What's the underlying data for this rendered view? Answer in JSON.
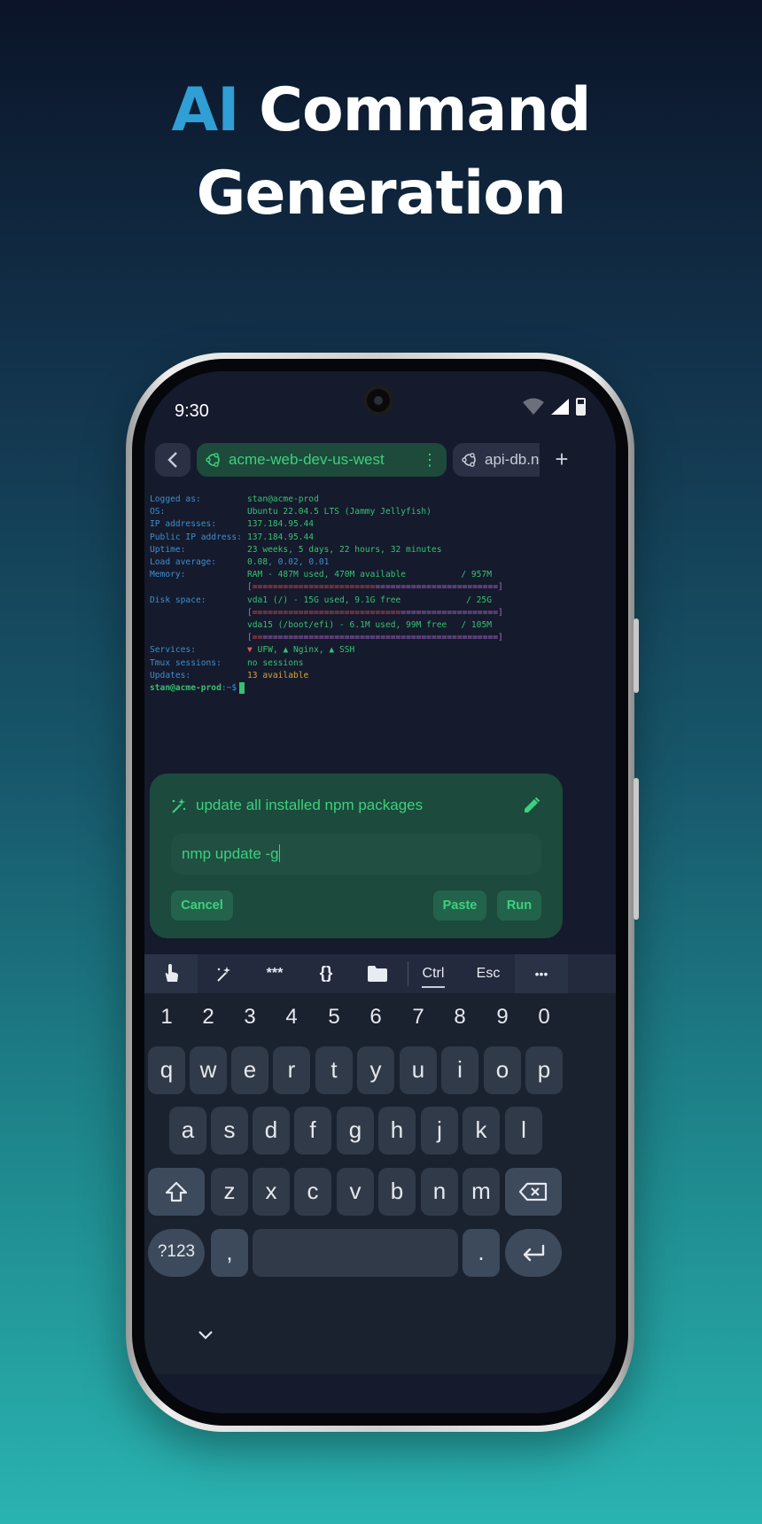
{
  "headline": {
    "accent": "AI",
    "line1_rest": " Command",
    "line2": "Generation"
  },
  "status_bar": {
    "time": "9:30"
  },
  "tabs": {
    "active": "acme-web-dev-us-west",
    "inactive": "api-db.n"
  },
  "terminal": {
    "rows": [
      {
        "label": "Logged as:",
        "value": "stan@acme-prod"
      },
      {
        "label": "OS:",
        "value": "Ubuntu 22.04.5 LTS (Jammy Jellyfish)"
      },
      {
        "label": "IP addresses:",
        "value": "137.184.95.44"
      },
      {
        "label": "Public IP address:",
        "value": "137.184.95.44"
      },
      {
        "label": "Uptime:",
        "value": "23 weeks, 5 days, 22 hours, 32 minutes"
      }
    ],
    "load": {
      "label": "Load average:",
      "v1": "0.08",
      "v2": "0.02",
      "v3": "0.01"
    },
    "memory": {
      "label": "Memory:",
      "text": "RAM - 487M used, 470M available",
      "total": "/ 957M",
      "bar_fill": "========================",
      "bar_rest": "========================"
    },
    "disk": {
      "label": "Disk space:",
      "vda1": "vda1 (/) - 15G used, 9.1G free",
      "vda1_total": "/ 25G",
      "vda1_fill": "=============================",
      "vda1_rest": "===================",
      "vda15": "vda15 (/boot/efi) - 6.1M used, 99M free",
      "vda15_total": "/ 105M",
      "vda15_fill": "==",
      "vda15_rest": "=============================================="
    },
    "services": {
      "label": "Services:",
      "ufw": "UFW,",
      "nginx": "Nginx,",
      "ssh": "SSH"
    },
    "tmux": {
      "label": "Tmux sessions:",
      "value": "no sessions"
    },
    "updates": {
      "label": "Updates:",
      "value": "13 available"
    },
    "prompt": {
      "user": "stan@acme-prod",
      "path": ":~$"
    }
  },
  "ai_card": {
    "prompt": "update all installed npm packages",
    "command": "nmp update -g",
    "cancel": "Cancel",
    "paste": "Paste",
    "run": "Run"
  },
  "toolbar": {
    "stars": "***",
    "braces": "{}",
    "ctrl": "Ctrl",
    "esc": "Esc",
    "more": "•••"
  },
  "keyboard": {
    "numbers": [
      "1",
      "2",
      "3",
      "4",
      "5",
      "6",
      "7",
      "8",
      "9",
      "0"
    ],
    "row1": [
      "q",
      "w",
      "e",
      "r",
      "t",
      "y",
      "u",
      "i",
      "o",
      "p"
    ],
    "row2": [
      "a",
      "s",
      "d",
      "f",
      "g",
      "h",
      "j",
      "k",
      "l"
    ],
    "row3": [
      "z",
      "x",
      "c",
      "v",
      "b",
      "n",
      "m"
    ],
    "symbols": "?123",
    "comma": ",",
    "period": "."
  },
  "colors": {
    "accent_blue": "#2f9fd6",
    "terminal_green": "#37c173",
    "card_bg": "#1c4a3c"
  }
}
